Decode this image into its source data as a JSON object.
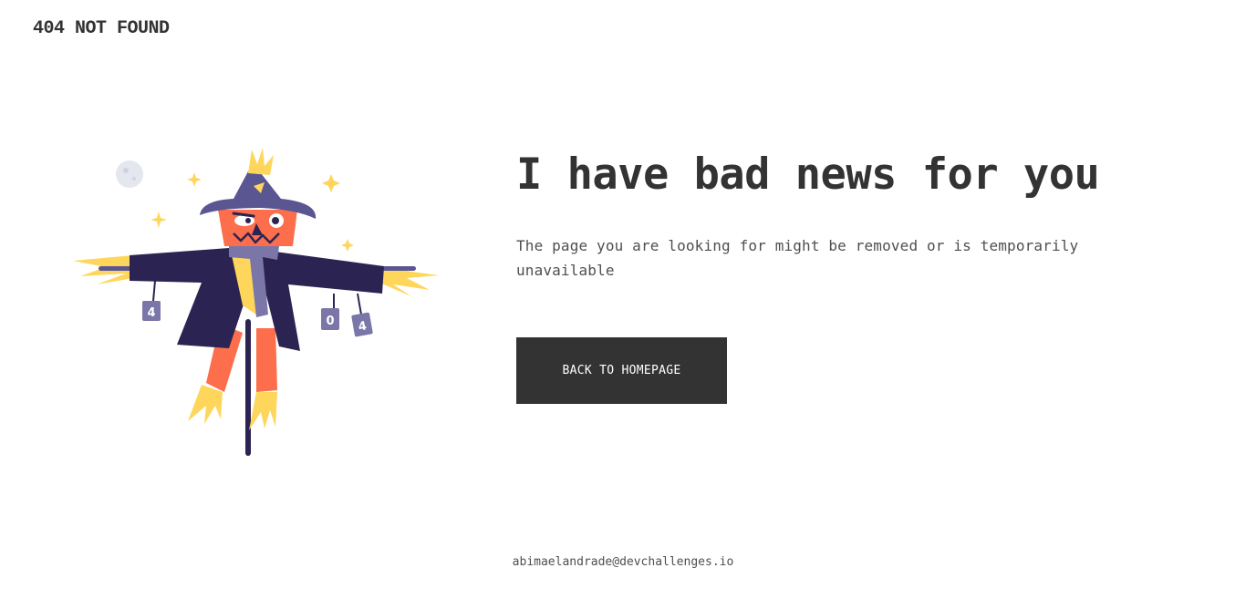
{
  "header": {
    "brand": "404 NOT FOUND"
  },
  "main": {
    "headline": "I have bad news for you",
    "description": "The page you are looking for might be removed or is temporarily unavailable",
    "button_label": "BACK TO HOMEPAGE",
    "illustration": {
      "can_labels": [
        "4",
        "0",
        "4"
      ]
    }
  },
  "footer": {
    "credit": "abimaelandrade@devchallenges.io"
  },
  "colors": {
    "text": "#333333",
    "button_bg": "#333333",
    "button_text": "#ffffff",
    "hat": "#5a5692",
    "coat": "#2b2452",
    "face": "#fc6e4c",
    "straw": "#ffd65c",
    "scarf": "#7a76a8"
  }
}
